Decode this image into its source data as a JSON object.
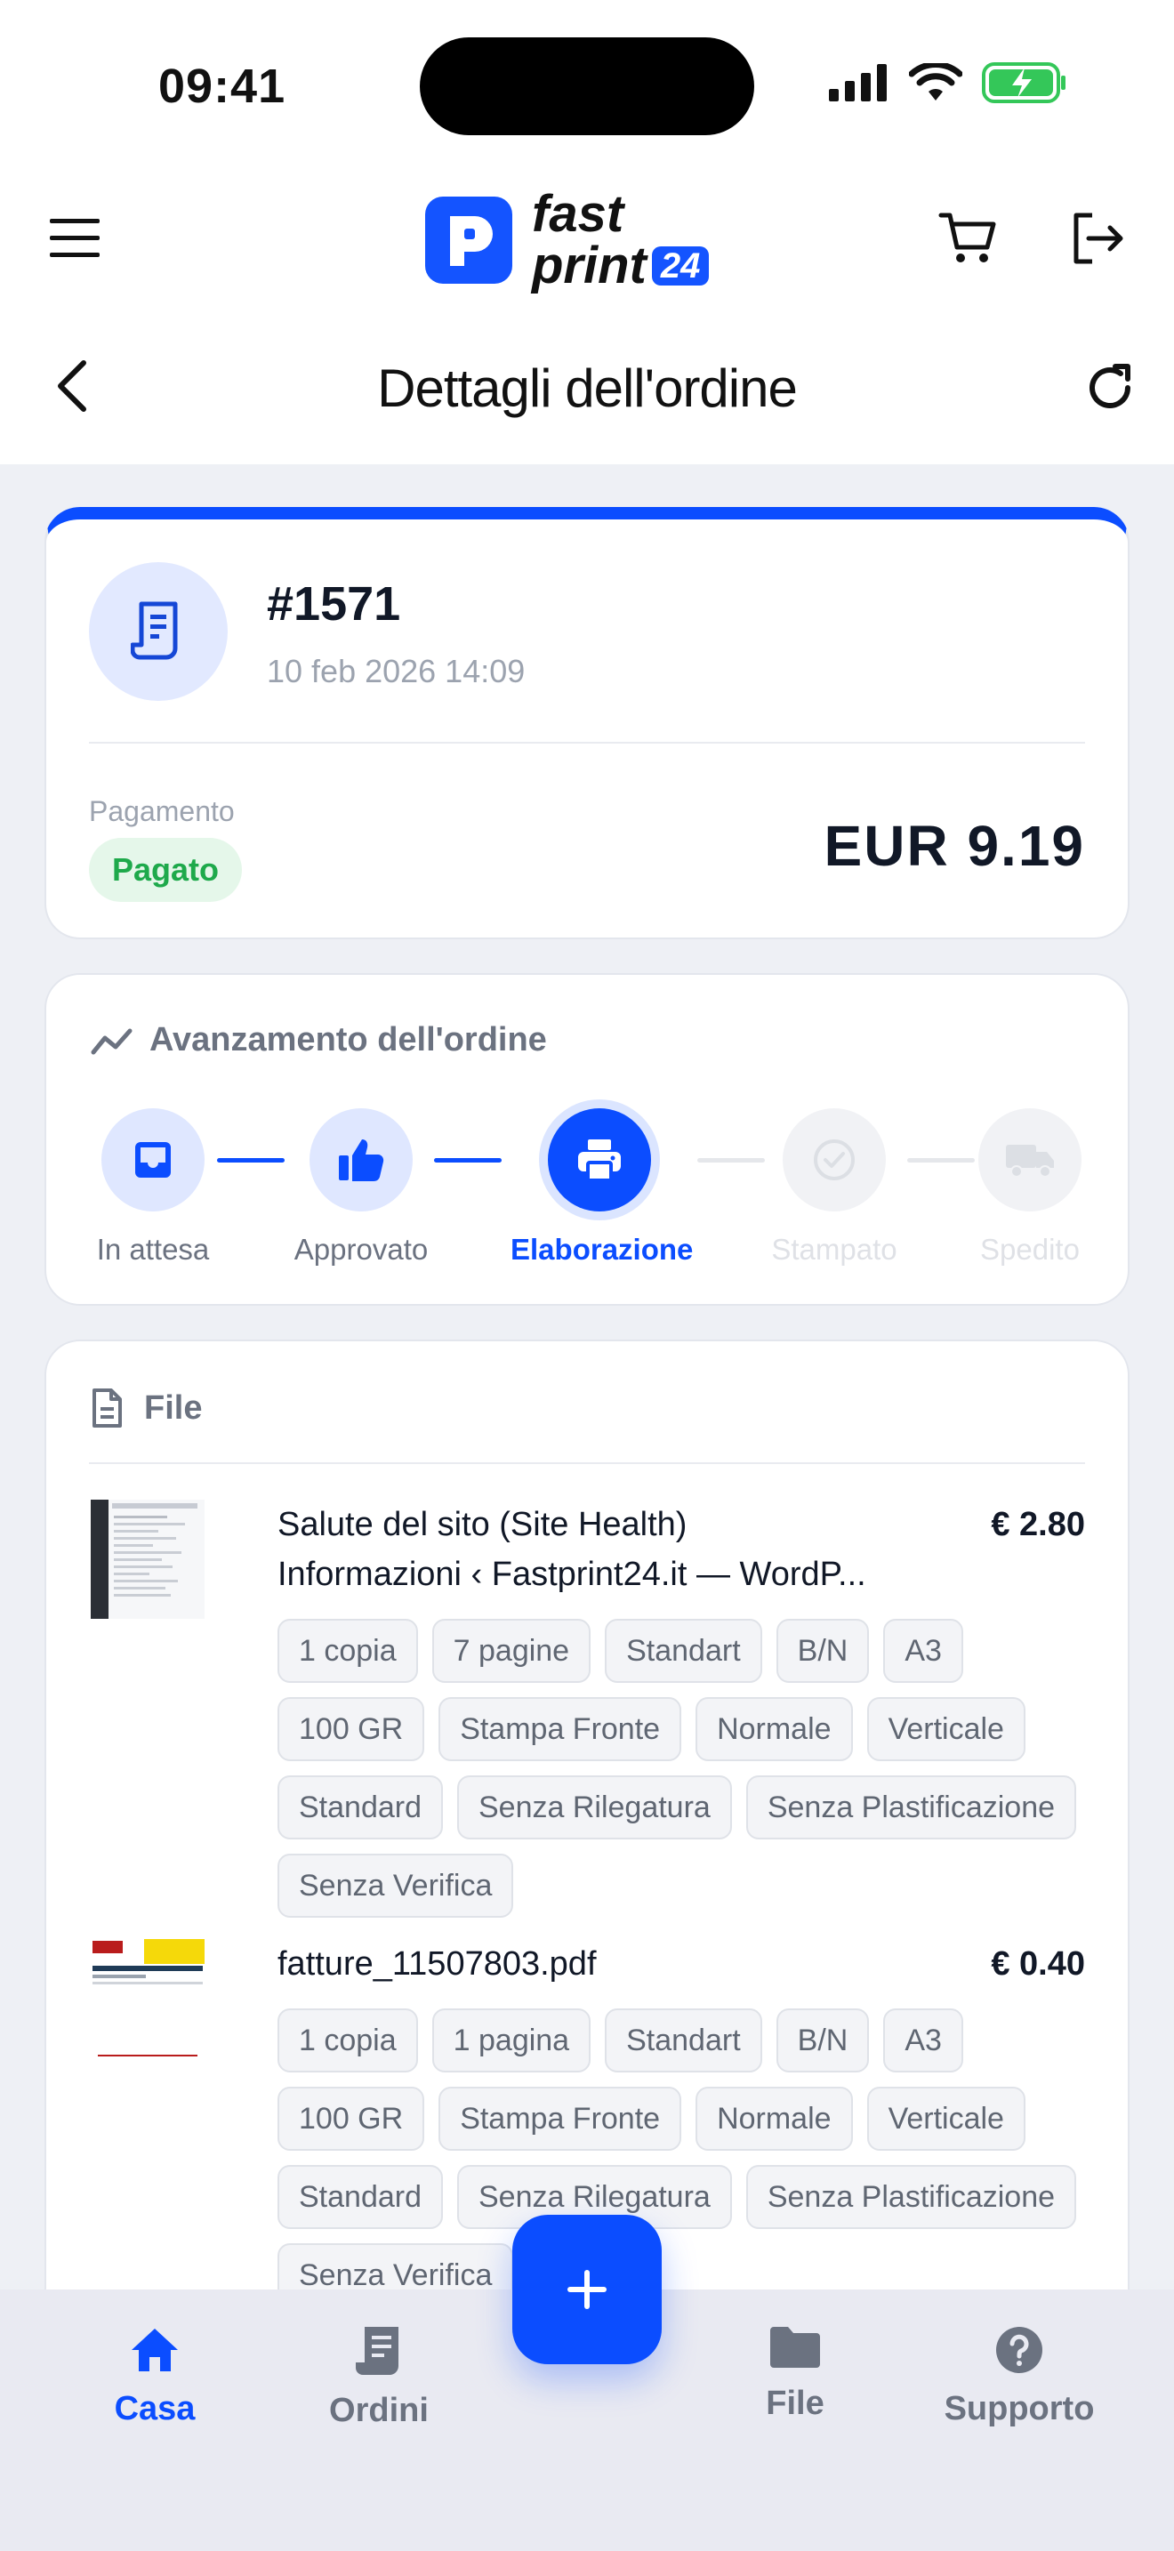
{
  "status_bar": {
    "time": "09:41"
  },
  "header": {
    "logo_line1": "fast",
    "logo_line2": "print",
    "logo_badge": "24"
  },
  "titlebar": {
    "title": "Dettagli dell'ordine"
  },
  "order": {
    "number": "#1571",
    "date": "10 feb 2026 14:09",
    "payment_label": "Pagamento",
    "payment_status": "Pagato",
    "amount": "EUR 9.19",
    "accent_color": "#0b4dff"
  },
  "progress": {
    "title": "Avanzamento dell'ordine",
    "steps": [
      {
        "label": "In attesa",
        "state": "done",
        "icon": "inbox-icon"
      },
      {
        "label": "Approvato",
        "state": "done",
        "icon": "thumbs-up-icon"
      },
      {
        "label": "Elaborazione",
        "state": "active",
        "icon": "printer-icon"
      },
      {
        "label": "Stampato",
        "state": "todo",
        "icon": "check-circle-icon"
      },
      {
        "label": "Spedito",
        "state": "todo",
        "icon": "truck-icon"
      }
    ]
  },
  "files": {
    "title": "File",
    "items": [
      {
        "name_line1": "Salute del sito (Site Health)",
        "name_line2": "Informazioni ‹ Fastprint24.it — WordP...",
        "price": "€ 2.80",
        "chips": [
          "1 copia",
          "7 pagine",
          "Standart",
          "B/N",
          "A3",
          "100 GR",
          "Stampa Fronte",
          "Normale",
          "Verticale",
          "Standard",
          "Senza Rilegatura",
          "Senza Plastificazione",
          "Senza Verifica"
        ]
      },
      {
        "name_line1": "fatture_11507803.pdf",
        "name_line2": "",
        "price": "€ 0.40",
        "chips": [
          "1 copia",
          "1 pagina",
          "Standart",
          "B/N",
          "A3",
          "100 GR",
          "Stampa Fronte",
          "Normale",
          "Verticale",
          "Standard",
          "Senza Rilegatura",
          "Senza Plastificazione",
          "Senza Verifica"
        ]
      }
    ]
  },
  "bottom_nav": {
    "items": [
      {
        "label": "Casa",
        "icon": "home-icon",
        "active": true
      },
      {
        "label": "Ordini",
        "icon": "receipt-icon",
        "active": false
      },
      {
        "label": "File",
        "icon": "folder-icon",
        "active": false
      },
      {
        "label": "Supporto",
        "icon": "help-icon",
        "active": false
      }
    ],
    "fab_icon": "plus-icon"
  }
}
